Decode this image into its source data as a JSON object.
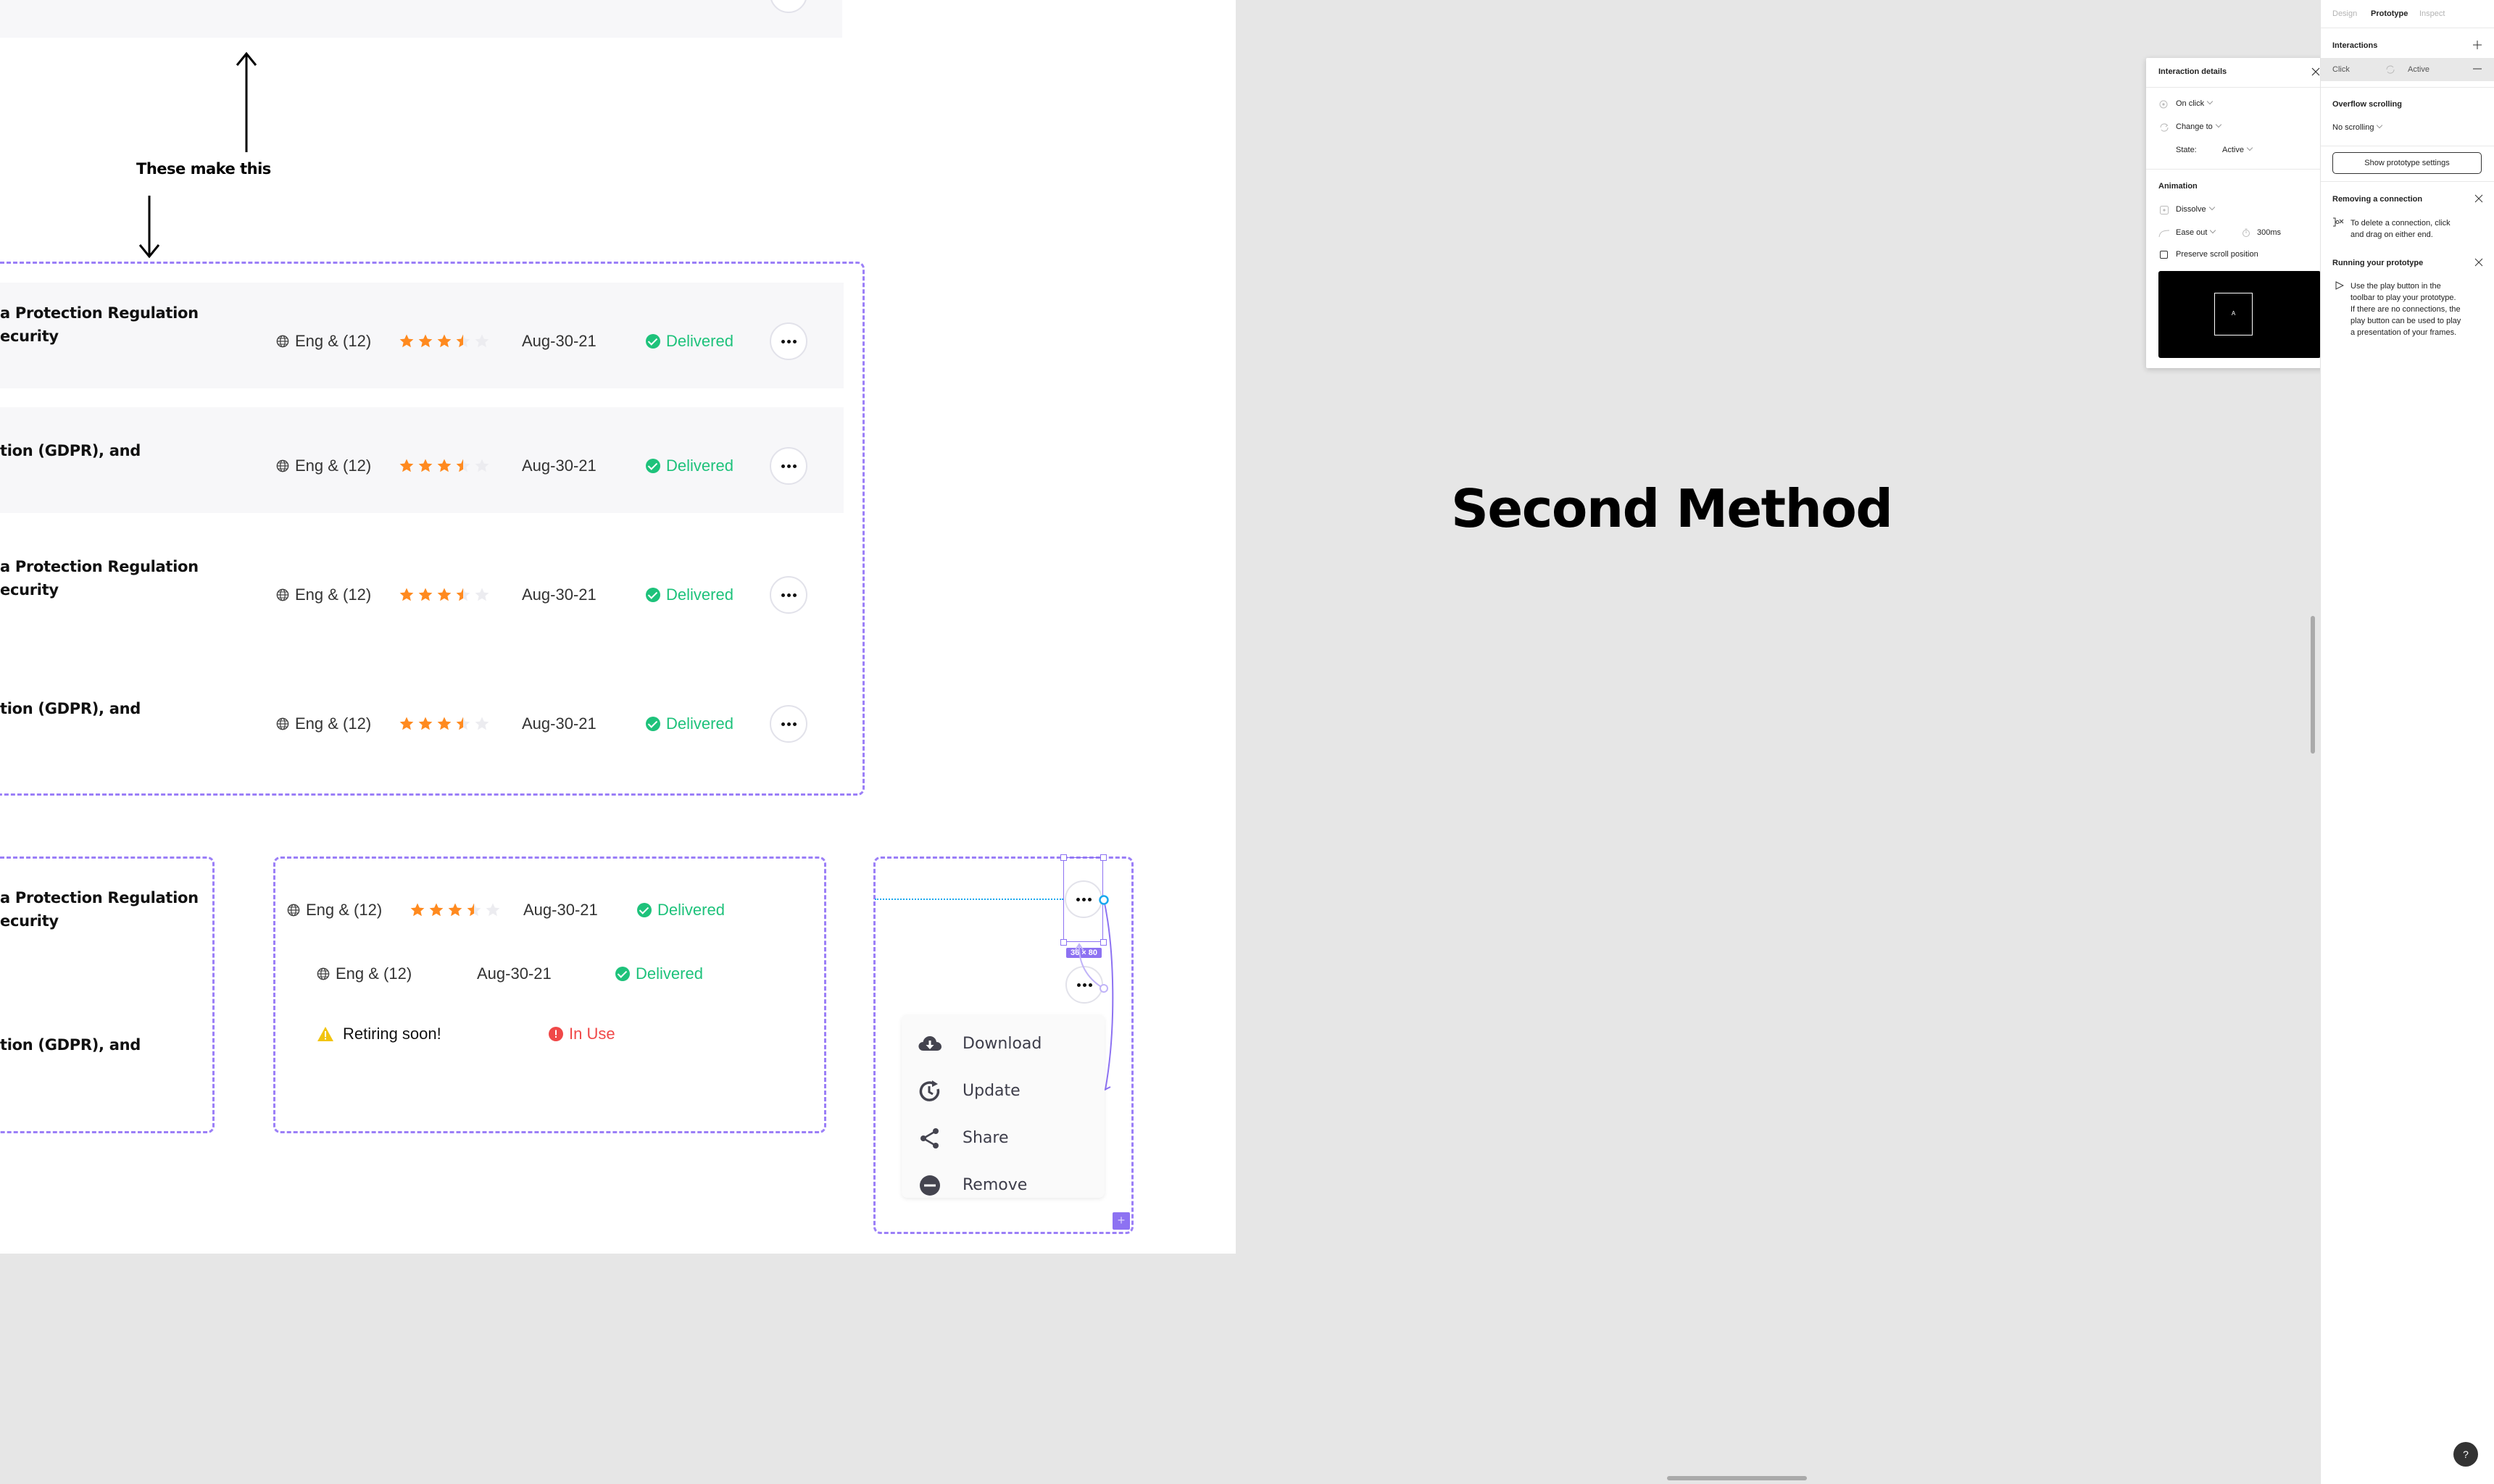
{
  "canvas": {
    "annotation": "These make this",
    "heading": "Second Method",
    "colors": {
      "dashed_frame": "#9b7ff7",
      "delivered": "#1ec27b",
      "star": "#ff8a1f",
      "in_use": "#f04848",
      "warning": "#f2c40f",
      "row_bg": "#f7f7f9"
    },
    "table_rows": [
      {
        "title_lines": [
          "a Protection Regulation",
          "ecurity"
        ],
        "language": "Eng & (12)",
        "rating": 3.5,
        "date": "Aug-30-21",
        "status": "Delivered"
      },
      {
        "title_lines": [
          "tion (GDPR), and"
        ],
        "language": "Eng & (12)",
        "rating": 3.5,
        "date": "Aug-30-21",
        "status": "Delivered"
      },
      {
        "title_lines": [
          "a Protection Regulation",
          "ecurity"
        ],
        "language": "Eng & (12)",
        "rating": 3.5,
        "date": "Aug-30-21",
        "status": "Delivered"
      },
      {
        "title_lines": [
          "tion (GDPR), and"
        ],
        "language": "Eng & (12)",
        "rating": 3.5,
        "date": "Aug-30-21",
        "status": "Delivered"
      }
    ],
    "title_component": {
      "line1": "a Protection Regulation",
      "line2": "ecurity",
      "line3": "tion (GDPR), and"
    },
    "meta_component": {
      "row1": {
        "language": "Eng & (12)",
        "rating": 3.5,
        "date": "Aug-30-21",
        "status": "Delivered"
      },
      "row2": {
        "language": "Eng & (12)",
        "date": "Aug-30-21",
        "status": "Delivered"
      },
      "row3": {
        "warning": "Retiring soon!",
        "status": "In Use"
      }
    },
    "menu_component": {
      "size_badge": "36 × 80",
      "items": [
        {
          "label": "Download",
          "icon": "cloud-download-icon"
        },
        {
          "label": "Update",
          "icon": "update-clock-icon"
        },
        {
          "label": "Share",
          "icon": "share-icon"
        },
        {
          "label": "Remove",
          "icon": "remove-circle-icon"
        }
      ]
    }
  },
  "interaction_details": {
    "title": "Interaction details",
    "trigger": "On click",
    "action": "Change to",
    "state_label": "State:",
    "state_value": "Active",
    "animation_label": "Animation",
    "animation_type": "Dissolve",
    "easing": "Ease out",
    "duration": "300ms",
    "preserve_scroll": "Preserve scroll position",
    "preserve_scroll_checked": false,
    "preview_letter": "A"
  },
  "right_panel": {
    "tabs": [
      "Design",
      "Prototype",
      "Inspect"
    ],
    "active_tab": "Prototype",
    "interactions_label": "Interactions",
    "interaction_row": {
      "trigger": "Click",
      "target": "Active"
    },
    "overflow_label": "Overflow scrolling",
    "overflow_value": "No scrolling",
    "settings_button": "Show prototype settings",
    "tip1": {
      "title": "Removing a connection",
      "body_lines": [
        "To delete a connection, click",
        "and drag on either end."
      ]
    },
    "tip2": {
      "title": "Running your prototype",
      "body_lines": [
        "Use the play button in the",
        "toolbar to play your prototype.",
        "If there are no connections, the",
        "play button can be used to play",
        "a presentation of your frames."
      ]
    },
    "help": "?"
  }
}
